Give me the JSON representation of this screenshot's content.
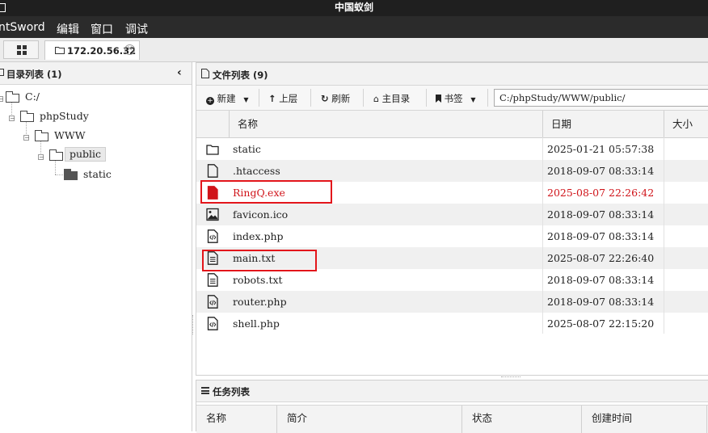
{
  "window": {
    "title": "中国蚁剑"
  },
  "menu": {
    "items": [
      "ntSword",
      "编辑",
      "窗口",
      "调试"
    ]
  },
  "tabs": {
    "host_label": "172.20.56.32"
  },
  "left_panel": {
    "title": "目录列表 (1)",
    "tree": [
      {
        "label": "C:/",
        "expanded": true
      },
      {
        "label": "phpStudy",
        "expanded": true
      },
      {
        "label": "WWW",
        "expanded": true
      },
      {
        "label": "public",
        "expanded": true,
        "selected": true
      },
      {
        "label": "static",
        "expanded": false
      }
    ]
  },
  "right_panel": {
    "title": "文件列表 (9)",
    "toolbar": {
      "new_label": "新建",
      "up_label": "上层",
      "refresh_label": "刷新",
      "home_label": "主目录",
      "bookmark_label": "书签",
      "path_value": "C:/phpStudy/WWW/public/"
    },
    "columns": {
      "name": "名称",
      "date": "日期",
      "size": "大小"
    },
    "files": [
      {
        "name": "static",
        "date": "2025-01-21 05:57:38",
        "icon": "folder-icon"
      },
      {
        "name": ".htaccess",
        "date": "2018-09-07 08:33:14",
        "icon": "file-icon"
      },
      {
        "name": "RingQ.exe",
        "date": "2025-08-07 22:26:42",
        "icon": "exe-file-icon",
        "highlight_color": "#d0141a"
      },
      {
        "name": "favicon.ico",
        "date": "2018-09-07 08:33:14",
        "icon": "image-file-icon"
      },
      {
        "name": "index.php",
        "date": "2018-09-07 08:33:14",
        "icon": "code-file-icon"
      },
      {
        "name": "main.txt",
        "date": "2025-08-07 22:26:40",
        "icon": "text-file-icon"
      },
      {
        "name": "robots.txt",
        "date": "2018-09-07 08:33:14",
        "icon": "text-file-icon"
      },
      {
        "name": "router.php",
        "date": "2018-09-07 08:33:14",
        "icon": "code-file-icon"
      },
      {
        "name": "shell.php",
        "date": "2025-08-07 22:15:20",
        "icon": "code-file-icon"
      }
    ]
  },
  "task_panel": {
    "title": "任务列表",
    "columns": {
      "name": "名称",
      "desc": "简介",
      "status": "状态",
      "created": "创建时间"
    }
  },
  "colors": {
    "annotation_red": "#e3161b",
    "new_file_red": "#d0141a",
    "titlebar": "#1f1f1f",
    "menubar": "#2b2b2b"
  }
}
